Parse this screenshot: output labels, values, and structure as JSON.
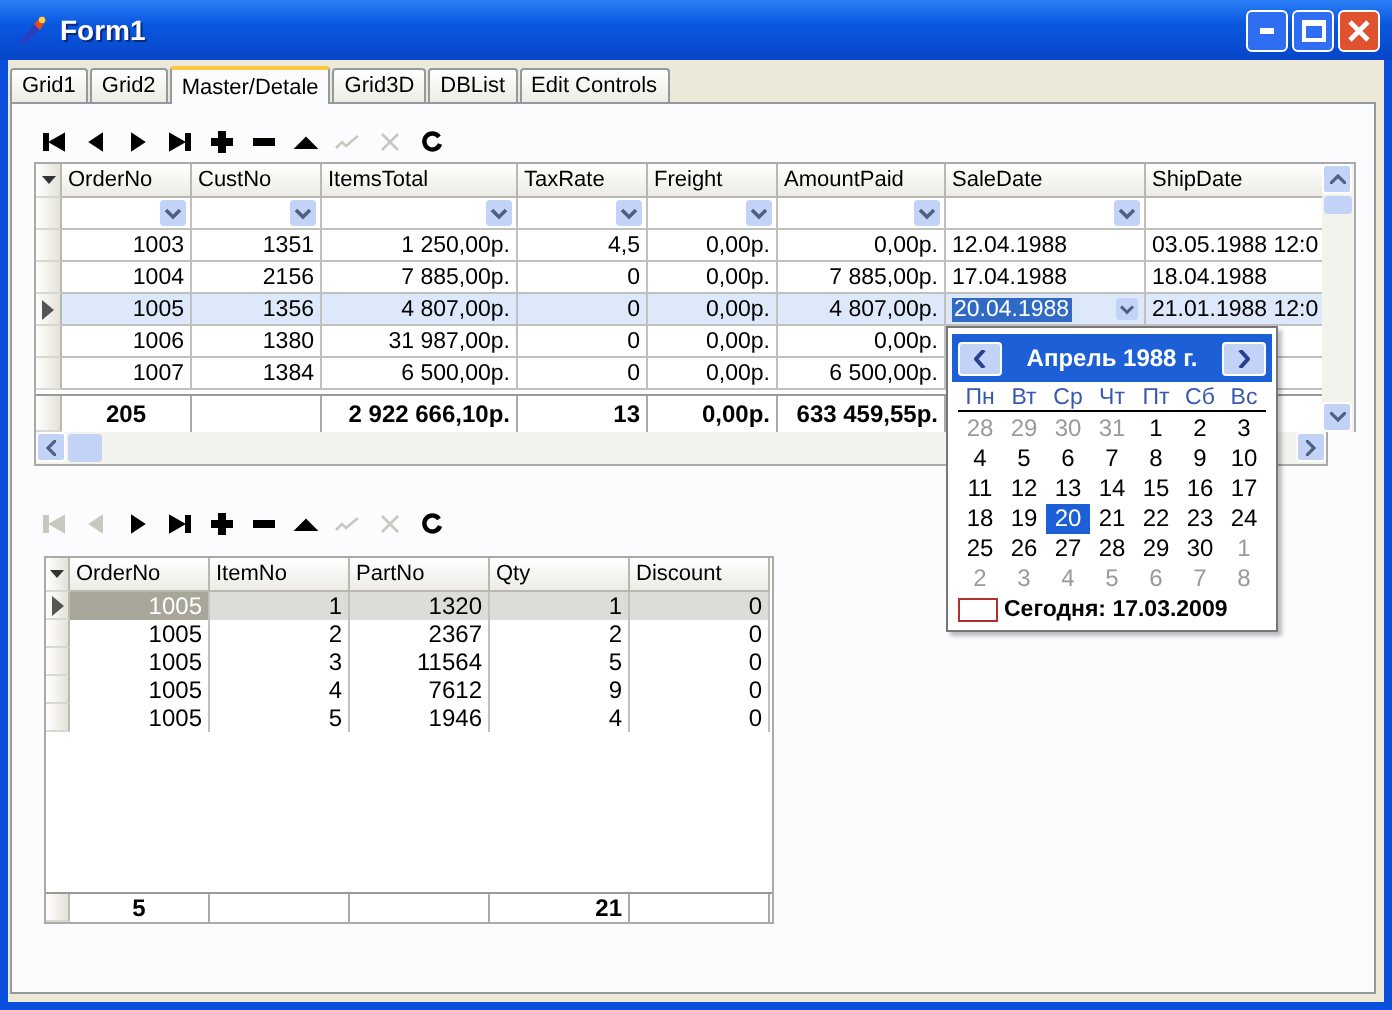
{
  "window": {
    "title": "Form1"
  },
  "tabs": [
    {
      "label": "Grid1",
      "selected": false
    },
    {
      "label": "Grid2",
      "selected": false
    },
    {
      "label": "Master/Detale",
      "selected": true
    },
    {
      "label": "Grid3D",
      "selected": false
    },
    {
      "label": "DBList",
      "selected": false
    },
    {
      "label": "Edit Controls",
      "selected": false
    }
  ],
  "master_toolbar": [
    {
      "kind": "first",
      "disabled": false
    },
    {
      "kind": "prior",
      "disabled": false
    },
    {
      "kind": "next",
      "disabled": false
    },
    {
      "kind": "last",
      "disabled": false
    },
    {
      "kind": "insert",
      "disabled": false
    },
    {
      "kind": "delete",
      "disabled": false
    },
    {
      "kind": "edit",
      "disabled": false
    },
    {
      "kind": "post",
      "disabled": true
    },
    {
      "kind": "cancel",
      "disabled": true
    },
    {
      "kind": "refresh",
      "disabled": false
    }
  ],
  "master_grid": {
    "columns": [
      {
        "title": "OrderNo",
        "filter": true
      },
      {
        "title": "CustNo",
        "filter": true
      },
      {
        "title": "ItemsTotal",
        "filter": true
      },
      {
        "title": "TaxRate",
        "filter": true
      },
      {
        "title": "Freight",
        "filter": true
      },
      {
        "title": "AmountPaid",
        "filter": true
      },
      {
        "title": "SaleDate",
        "filter": true
      },
      {
        "title": "ShipDate",
        "filter": false
      }
    ],
    "rows": [
      {
        "selected": false,
        "cells": [
          "1003",
          "1351",
          "1 250,00р.",
          "4,5",
          "0,00р.",
          "0,00р.",
          "12.04.1988",
          "03.05.1988 12:0"
        ]
      },
      {
        "selected": false,
        "cells": [
          "1004",
          "2156",
          "7 885,00р.",
          "0",
          "0,00р.",
          "7 885,00р.",
          "17.04.1988",
          "18.04.1988"
        ]
      },
      {
        "selected": true,
        "cells": [
          "1005",
          "1356",
          "4 807,00р.",
          "0",
          "0,00р.",
          "4 807,00р.",
          {
            "text": "20.04.1988",
            "editing": true
          },
          "21.01.1988 12:0"
        ]
      },
      {
        "selected": false,
        "cells": [
          "1006",
          "1380",
          "31 987,00р.",
          "0",
          "0,00р.",
          "0,00р."
        ]
      },
      {
        "selected": false,
        "cells": [
          "1007",
          "1384",
          "6 500,00р.",
          "0",
          "0,00р.",
          "6 500,00р."
        ]
      }
    ],
    "footer": [
      {
        "kind": "total",
        "text": "205"
      },
      {
        "kind": "blank"
      },
      {
        "kind": "total",
        "text": "2 922 666,10р."
      },
      {
        "kind": "total",
        "text": "13"
      },
      {
        "kind": "total",
        "text": "0,00р."
      },
      {
        "kind": "total",
        "text": "633 459,55р."
      }
    ]
  },
  "calendar": {
    "month": "Апрель 1988 г.",
    "weekdays": [
      "Пн",
      "Вт",
      "Ср",
      "Чт",
      "Пт",
      "Сб",
      "Вс"
    ],
    "weeks": [
      [
        {
          "d": "28",
          "other": true,
          "selected": false
        },
        {
          "d": "29",
          "other": true,
          "selected": false
        },
        {
          "d": "30",
          "other": true,
          "selected": false
        },
        {
          "d": "31",
          "other": true,
          "selected": false
        },
        {
          "d": "1",
          "other": false,
          "selected": false
        },
        {
          "d": "2",
          "other": false,
          "selected": false
        },
        {
          "d": "3",
          "other": false,
          "selected": false
        }
      ],
      [
        {
          "d": "4",
          "other": false,
          "selected": false
        },
        {
          "d": "5",
          "other": false,
          "selected": false
        },
        {
          "d": "6",
          "other": false,
          "selected": false
        },
        {
          "d": "7",
          "other": false,
          "selected": false
        },
        {
          "d": "8",
          "other": false,
          "selected": false
        },
        {
          "d": "9",
          "other": false,
          "selected": false
        },
        {
          "d": "10",
          "other": false,
          "selected": false
        }
      ],
      [
        {
          "d": "11",
          "other": false,
          "selected": false
        },
        {
          "d": "12",
          "other": false,
          "selected": false
        },
        {
          "d": "13",
          "other": false,
          "selected": false
        },
        {
          "d": "14",
          "other": false,
          "selected": false
        },
        {
          "d": "15",
          "other": false,
          "selected": false
        },
        {
          "d": "16",
          "other": false,
          "selected": false
        },
        {
          "d": "17",
          "other": false,
          "selected": false
        }
      ],
      [
        {
          "d": "18",
          "other": false,
          "selected": false
        },
        {
          "d": "19",
          "other": false,
          "selected": false
        },
        {
          "d": "20",
          "other": false,
          "selected": true
        },
        {
          "d": "21",
          "other": false,
          "selected": false
        },
        {
          "d": "22",
          "other": false,
          "selected": false
        },
        {
          "d": "23",
          "other": false,
          "selected": false
        },
        {
          "d": "24",
          "other": false,
          "selected": false
        }
      ],
      [
        {
          "d": "25",
          "other": false,
          "selected": false
        },
        {
          "d": "26",
          "other": false,
          "selected": false
        },
        {
          "d": "27",
          "other": false,
          "selected": false
        },
        {
          "d": "28",
          "other": false,
          "selected": false
        },
        {
          "d": "29",
          "other": false,
          "selected": false
        },
        {
          "d": "30",
          "other": false,
          "selected": false
        },
        {
          "d": "1",
          "other": true,
          "selected": false
        }
      ],
      [
        {
          "d": "2",
          "other": true,
          "selected": false
        },
        {
          "d": "3",
          "other": true,
          "selected": false
        },
        {
          "d": "4",
          "other": true,
          "selected": false
        },
        {
          "d": "5",
          "other": true,
          "selected": false
        },
        {
          "d": "6",
          "other": true,
          "selected": false
        },
        {
          "d": "7",
          "other": true,
          "selected": false
        },
        {
          "d": "8",
          "other": true,
          "selected": false
        }
      ]
    ],
    "today": "Сегодня: 17.03.2009"
  },
  "detail_toolbar": [
    {
      "kind": "first",
      "disabled": true
    },
    {
      "kind": "prior",
      "disabled": true
    },
    {
      "kind": "next",
      "disabled": false
    },
    {
      "kind": "last",
      "disabled": false
    },
    {
      "kind": "insert",
      "disabled": false
    },
    {
      "kind": "delete",
      "disabled": false
    },
    {
      "kind": "edit",
      "disabled": false
    },
    {
      "kind": "post",
      "disabled": true
    },
    {
      "kind": "cancel",
      "disabled": true
    },
    {
      "kind": "refresh",
      "disabled": false
    }
  ],
  "detail_grid": {
    "columns": [
      "OrderNo",
      "ItemNo",
      "PartNo",
      "Qty",
      "Discount"
    ],
    "rows": [
      {
        "selected": true,
        "cells": [
          "1005",
          "1",
          "1320",
          "1",
          "0"
        ]
      },
      {
        "selected": false,
        "cells": [
          "1005",
          "2",
          "2367",
          "2",
          "0"
        ]
      },
      {
        "selected": false,
        "cells": [
          "1005",
          "3",
          "11564",
          "5",
          "0"
        ]
      },
      {
        "selected": false,
        "cells": [
          "1005",
          "4",
          "7612",
          "9",
          "0"
        ]
      },
      {
        "selected": false,
        "cells": [
          "1005",
          "5",
          "1946",
          "4",
          "0"
        ]
      }
    ],
    "footer": [
      {
        "kind": "total",
        "text": "5"
      },
      {
        "kind": "blank"
      },
      {
        "kind": "blank"
      },
      {
        "kind": "total",
        "text": "21"
      },
      {
        "kind": "blank"
      }
    ]
  }
}
